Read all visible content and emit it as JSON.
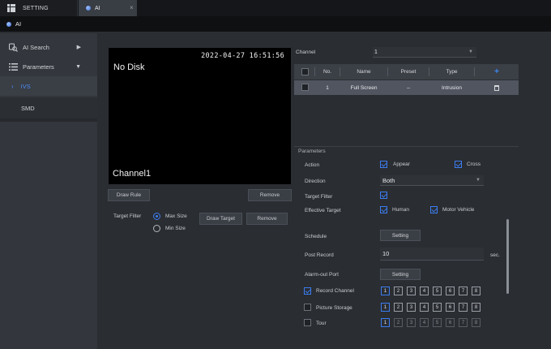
{
  "tabs": {
    "setting_label": "SETTING",
    "ai_label": "AI",
    "close_glyph": "×"
  },
  "subbar": {
    "title": "AI"
  },
  "sidebar": {
    "items": [
      {
        "label": "AI Search",
        "icon": "ai-search-icon"
      },
      {
        "label": "Parameters",
        "icon": "list-icon"
      },
      {
        "label": "IVS",
        "icon": "chevron-right-icon"
      },
      {
        "label": "SMD"
      }
    ]
  },
  "video": {
    "timestamp": "2022-04-27 16:51:56",
    "no_disk": "No Disk",
    "channel": "Channel1"
  },
  "rule_buttons": {
    "draw_rule": "Draw Rule",
    "remove": "Remove"
  },
  "target_filter": {
    "label": "Target Filter",
    "options": [
      "Max Size",
      "Min Size"
    ],
    "selected": "Max Size",
    "draw_target": "Draw Target",
    "remove": "Remove"
  },
  "channel": {
    "label": "Channel",
    "value": "1"
  },
  "rules_table": {
    "headers": [
      "No.",
      "Name",
      "Preset",
      "Type"
    ],
    "rows": [
      {
        "no": "1",
        "name": "Full Screen",
        "preset": "--",
        "type": "Intrusion"
      }
    ]
  },
  "parameters": {
    "section_label": "Parameters",
    "action_label": "Action",
    "action_appear": "Appear",
    "action_cross": "Cross",
    "direction_label": "Direction",
    "direction_value": "Both",
    "target_filter_label": "Target Filter",
    "effective_target_label": "Effective Target",
    "effective_human": "Human",
    "effective_motor": "Motor Vehicle",
    "schedule_label": "Schedule",
    "schedule_btn": "Setting",
    "post_record_label": "Post Record",
    "post_record_value": "10",
    "post_record_unit": "sec.",
    "alarm_out_label": "Alarm-out Port",
    "alarm_out_btn": "Setting",
    "record_channel_label": "Record Channel",
    "picture_storage_label": "Picture Storage",
    "tour_label": "Tour",
    "channel_numbers": [
      "1",
      "2",
      "3",
      "4",
      "5",
      "6",
      "7",
      "8"
    ]
  },
  "colors": {
    "accent": "#3b7df0",
    "background": "#2a2d32",
    "sidebar": "#33363c"
  }
}
